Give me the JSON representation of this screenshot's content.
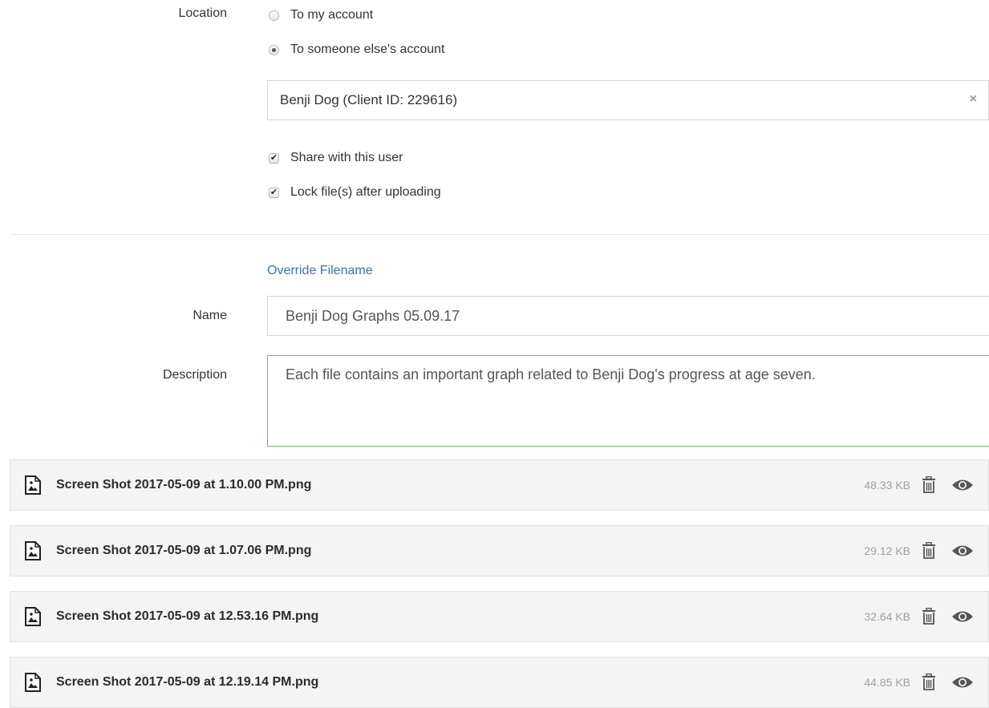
{
  "location": {
    "label": "Location",
    "option_mine": "To my account",
    "option_other": "To someone else's account",
    "selected": "other",
    "recipient": {
      "value": "Benji Dog (Client ID: 229616)",
      "clear_glyph": "×"
    }
  },
  "options": {
    "share_label": "Share with this user",
    "share_checked": true,
    "lock_label": "Lock file(s) after uploading",
    "lock_checked": true,
    "check_glyph": "✔"
  },
  "override_link": "Override Filename",
  "name": {
    "label": "Name",
    "value": "Benji Dog Graphs 05.09.17"
  },
  "description": {
    "label": "Description",
    "value": "Each file contains an important graph related to Benji Dog's progress at age seven."
  },
  "files": [
    {
      "name": "Screen Shot 2017-05-09 at 1.10.00 PM.png",
      "size": "48.33 KB"
    },
    {
      "name": "Screen Shot 2017-05-09 at 1.07.06 PM.png",
      "size": "29.12 KB"
    },
    {
      "name": "Screen Shot 2017-05-09 at 12.53.16 PM.png",
      "size": "32.64 KB"
    },
    {
      "name": "Screen Shot 2017-05-09 at 12.19.14 PM.png",
      "size": "44.85 KB"
    }
  ],
  "icons": {
    "file": "image-file-icon",
    "delete": "trash-icon",
    "preview": "eye-icon"
  },
  "colors": {
    "link": "#3a73b8",
    "focus_border": "#6abf6a",
    "row_background": "#f4f4f4"
  }
}
